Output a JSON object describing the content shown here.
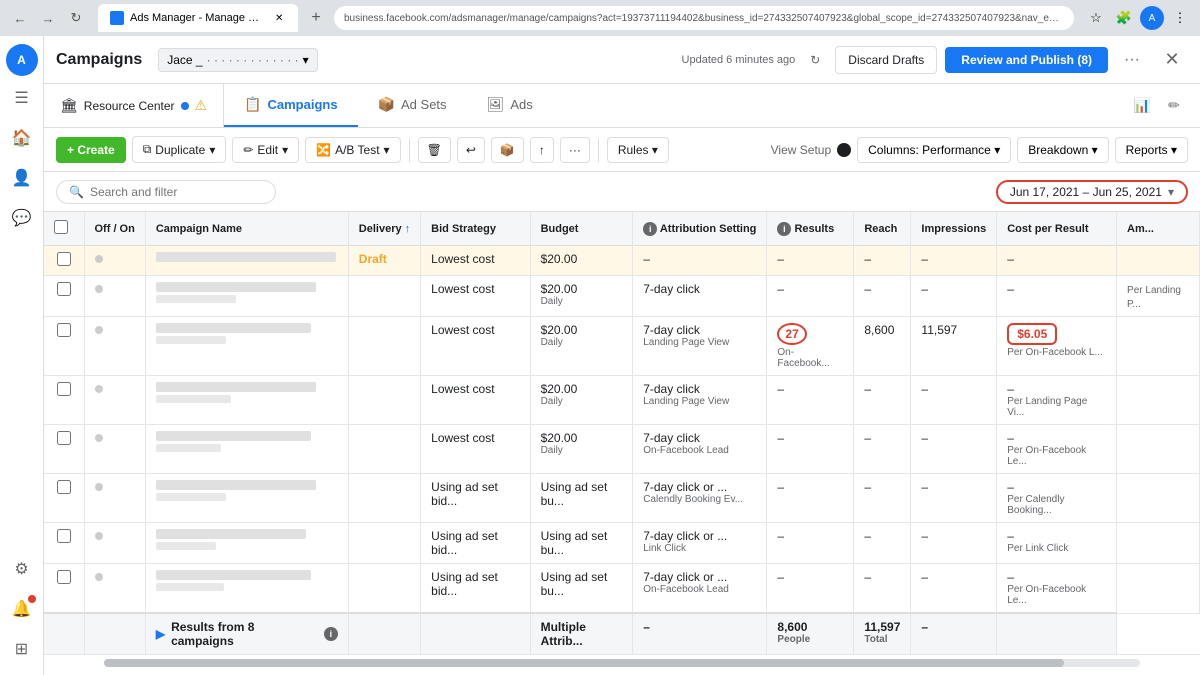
{
  "browser": {
    "tab_title": "Ads Manager - Manage Ca...",
    "tab_new": "+",
    "address": "business.facebook.com/adsmanager/manage/campaigns?act=19373711194402&business_id=274332507407923&global_scope_id=274332507407923&nav_entry_point=bm_global_nav_shortcut&date...",
    "controls": [
      "←",
      "→",
      "↻"
    ]
  },
  "header": {
    "title": "Campaigns",
    "account": "Jace _",
    "account_placeholder": "· · · · · · · · · · · · ·",
    "updated_text": "Updated 6 minutes ago",
    "discard_label": "Discard Drafts",
    "review_label": "Review and Publish (8)",
    "more": "···",
    "close": "✕"
  },
  "nav": {
    "resource_center": "Resource Center",
    "tabs": [
      {
        "label": "Campaigns",
        "icon": "📋",
        "active": true
      },
      {
        "label": "Ad Sets",
        "icon": "📦",
        "active": false
      },
      {
        "label": "Ads",
        "icon": "🖼",
        "active": false
      }
    ]
  },
  "toolbar": {
    "create_label": "+ Create",
    "duplicate_label": "Duplicate",
    "edit_label": "Edit",
    "ab_test_label": "A/B Test",
    "delete_label": "🗑",
    "undo_label": "↩",
    "trash_label": "🗑",
    "archive_label": "📦",
    "more_label": "···",
    "rules_label": "Rules ▾",
    "view_setup": "View Setup",
    "columns_label": "Columns: Performance ▾",
    "breakdown_label": "Breakdown ▾",
    "reports_label": "Reports ▾"
  },
  "search": {
    "placeholder": "Search and filter"
  },
  "date_range": {
    "label": "Jun 17, 2021 – Jun 25, 2021",
    "arrow": "▾"
  },
  "table": {
    "columns": [
      "Off / On",
      "Campaign Name",
      "Delivery ↑",
      "Bid Strategy",
      "Budget",
      "Attribution Setting",
      "Results",
      "Reach",
      "Impressions",
      "Cost per Result",
      "Am..."
    ],
    "rows": [
      {
        "on_off": "off",
        "name": "",
        "delivery": "Draft",
        "bid": "Lowest cost",
        "budget": "$20.00",
        "budget_period": "",
        "attribution": "–",
        "results": "–",
        "reach": "–",
        "impressions": "–",
        "cost": "–",
        "amount": ""
      },
      {
        "on_off": "off",
        "name": "",
        "delivery": "",
        "bid": "Lowest cost",
        "budget": "$20.00",
        "budget_period": "Daily",
        "attribution": "7-day click",
        "results": "–",
        "reach": "–",
        "impressions": "–",
        "cost": "–",
        "amount": "Per Landing P..."
      },
      {
        "on_off": "off",
        "name": "",
        "delivery": "",
        "bid": "Lowest cost",
        "budget": "$20.00",
        "budget_period": "Daily",
        "attribution": "7-day click",
        "attribution_sub": "Landing Page View",
        "results_val": "27",
        "results_circled": true,
        "results_sub": "On-Facebook...",
        "reach": "8,600",
        "impressions": "11,597",
        "cost_val": "$6.05",
        "cost_circled": true,
        "cost_sub": "Per On-Facebook L...",
        "amount": ""
      },
      {
        "on_off": "off",
        "name": "",
        "delivery": "",
        "bid": "Lowest cost",
        "budget": "$20.00",
        "budget_period": "Daily",
        "attribution": "7-day click",
        "attribution_sub": "Landing Page View",
        "results": "–",
        "reach": "–",
        "impressions": "–",
        "cost": "–",
        "cost_sub": "Per Landing Page Vi...",
        "amount": ""
      },
      {
        "on_off": "off",
        "name": "",
        "delivery": "",
        "bid": "Lowest cost",
        "budget": "$20.00",
        "budget_period": "Daily",
        "attribution": "7-day click",
        "attribution_sub": "On-Facebook Lead",
        "results": "–",
        "reach": "–",
        "impressions": "–",
        "cost": "–",
        "cost_sub": "Per On-Facebook Le...",
        "amount": ""
      },
      {
        "on_off": "off",
        "name": "",
        "delivery": "",
        "bid": "Using ad set bid...",
        "budget": "Using ad set bu...",
        "attribution": "7-day click or ...",
        "attribution_sub": "Calendly Booking Ev...",
        "results": "–",
        "reach": "–",
        "impressions": "–",
        "cost": "–",
        "cost_sub": "Per Calendly Booking...",
        "amount": ""
      },
      {
        "on_off": "off",
        "name": "",
        "delivery": "",
        "bid": "Using ad set bid...",
        "budget": "Using ad set bu...",
        "attribution": "7-day click or ...",
        "attribution_sub": "Link Click",
        "results": "–",
        "reach": "–",
        "impressions": "–",
        "cost": "–",
        "cost_sub": "Per Link Click",
        "amount": ""
      },
      {
        "on_off": "off",
        "name": "",
        "delivery": "",
        "bid": "Using ad set bid...",
        "budget": "Using ad set bu...",
        "attribution": "7-day click or ...",
        "attribution_sub": "On-Facebook Lead",
        "results": "–",
        "reach": "–",
        "impressions": "–",
        "cost": "–",
        "cost_sub": "Per On-Facebook Le...",
        "amount": ""
      }
    ],
    "summary": {
      "label": "Results from 8 campaigns",
      "attribution": "Multiple Attrib...",
      "results": "–",
      "reach": "8,600",
      "reach_sub": "People",
      "impressions": "11,597",
      "impressions_sub": "Total",
      "cost": "–"
    }
  },
  "sidebar": {
    "icons": [
      "☰",
      "🏠",
      "👤",
      "💬",
      "☰"
    ]
  },
  "colors": {
    "accent_blue": "#1877f2",
    "accent_green": "#42b72a",
    "accent_red": "#e03e2d",
    "text_dark": "#1c1e21",
    "text_gray": "#65676b",
    "bg_draft": "#fff8e6"
  }
}
